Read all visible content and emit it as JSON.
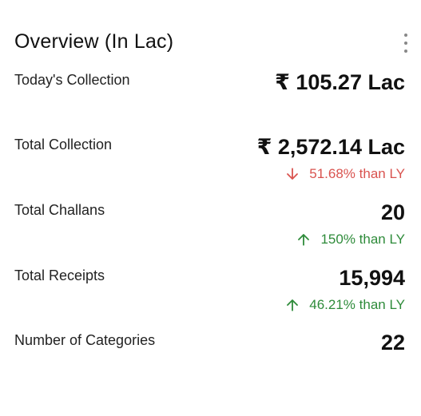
{
  "card": {
    "title": "Overview (In Lac)"
  },
  "rows": [
    {
      "label": "Today's Collection",
      "value": "₹ 105.27 Lac",
      "change": null
    },
    {
      "label": "Total Collection",
      "value": "₹ 2,572.14 Lac",
      "change": {
        "text": "51.68% than LY",
        "direction": "down",
        "color": "#d9534f",
        "icon": "arrow-down-icon"
      }
    },
    {
      "label": "Total Challans",
      "value": "20",
      "change": {
        "text": "150% than LY",
        "direction": "up",
        "color": "#2e8b3a",
        "icon": "arrow-up-icon"
      }
    },
    {
      "label": "Total Receipts",
      "value": "15,994",
      "change": {
        "text": "46.21% than LY",
        "direction": "up",
        "color": "#2e8b3a",
        "icon": "arrow-up-icon"
      }
    },
    {
      "label": "Number of Categories",
      "value": "22",
      "change": null
    }
  ],
  "icons": {
    "menu": "more-vertical-icon"
  }
}
